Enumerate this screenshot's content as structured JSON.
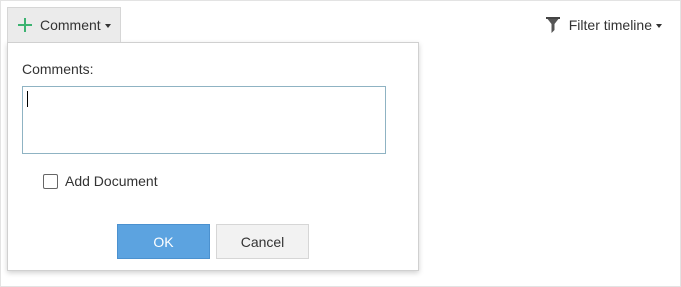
{
  "toolbar": {
    "comment_label": "Comment",
    "comment_icon": "plus-icon",
    "filter_label": "Filter timeline",
    "filter_icon": "filter-icon"
  },
  "comment_popover": {
    "comments_label": "Comments:",
    "comments_value": "",
    "add_document_label": "Add Document",
    "add_document_checked": false,
    "ok_label": "OK",
    "cancel_label": "Cancel"
  },
  "colors": {
    "plus_icon": "#3cb371",
    "ok_button": "#5ca3e0",
    "textarea_border": "#8fb3c3",
    "comment_button_bg": "#ebebeb"
  }
}
